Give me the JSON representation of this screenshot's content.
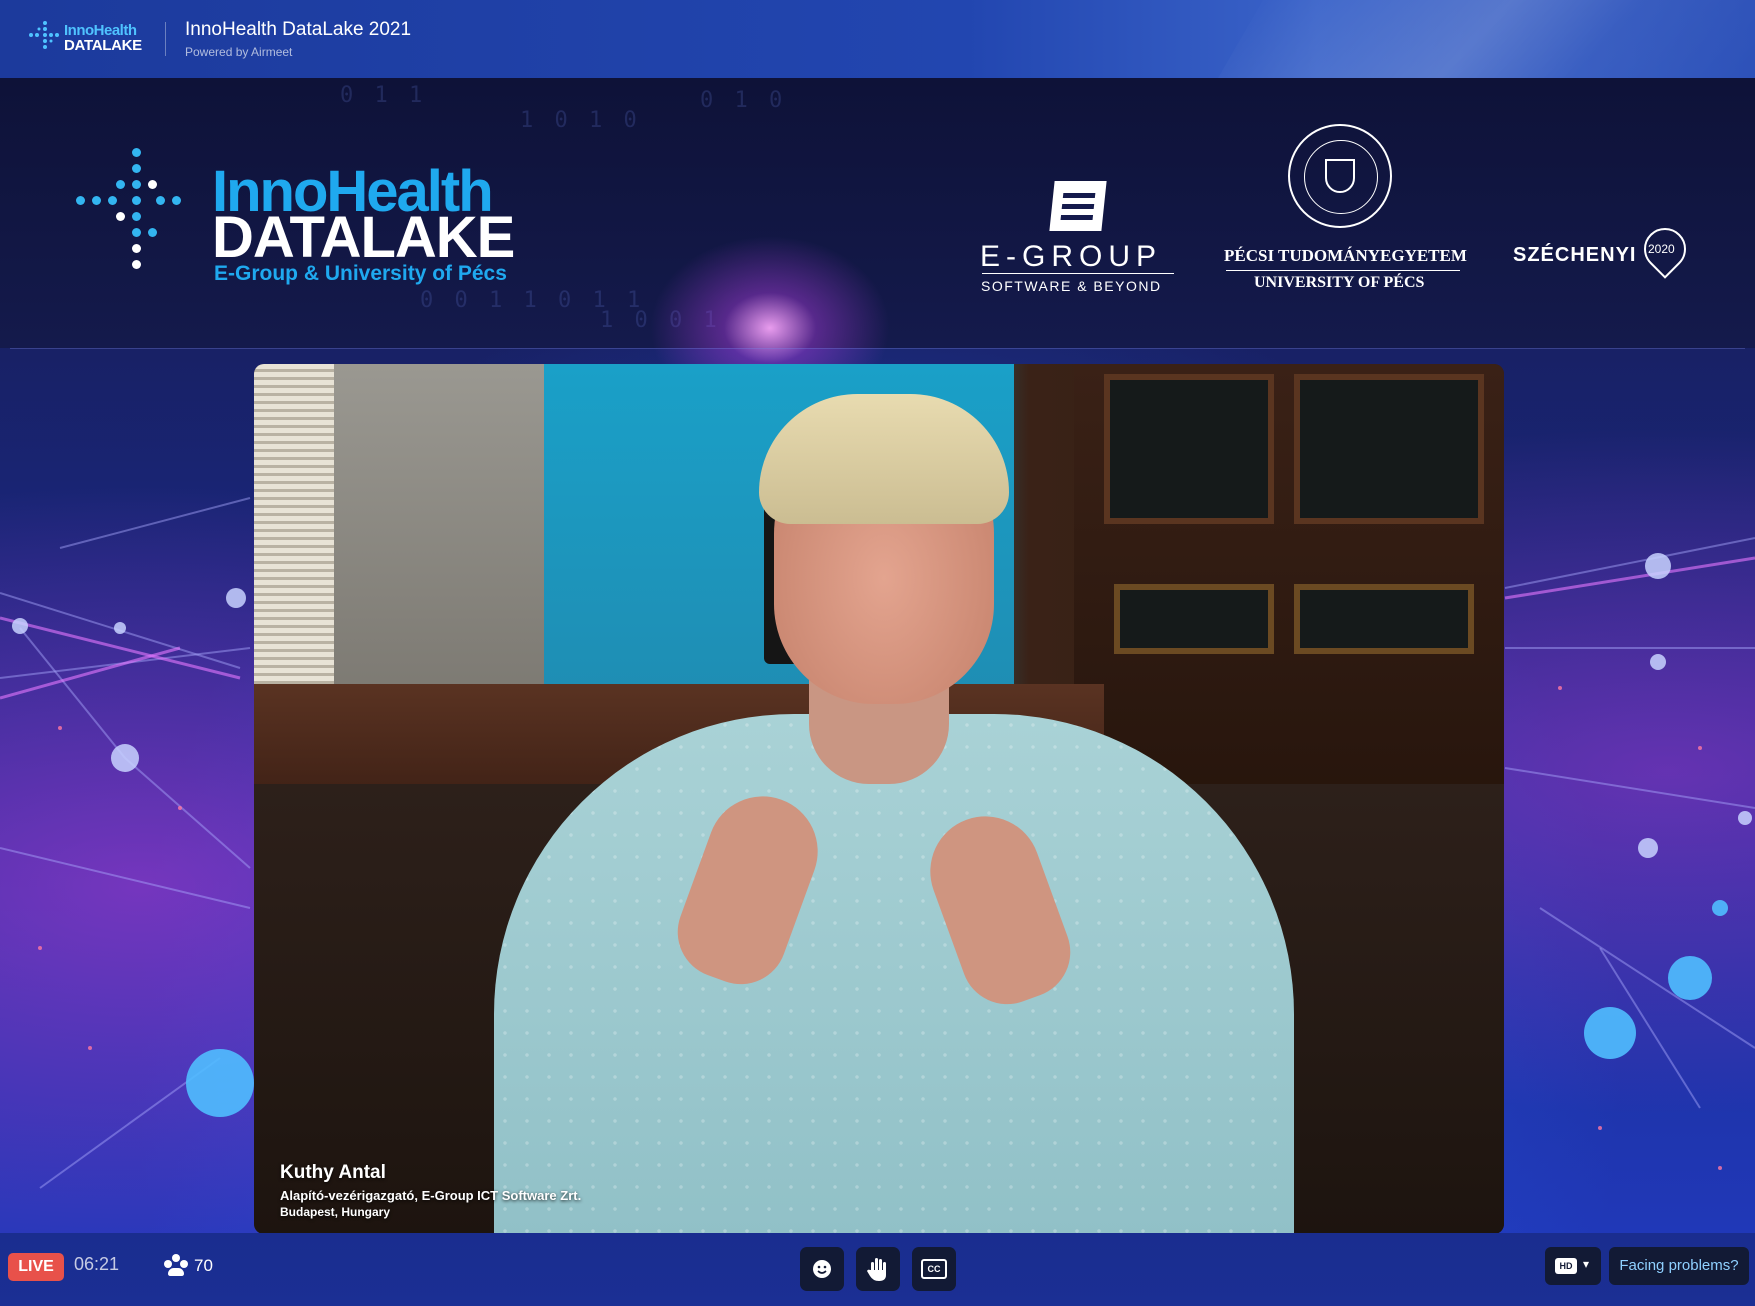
{
  "header": {
    "logo_line1": "InnoHealth",
    "logo_line2": "DATALAKE",
    "title": "InnoHealth DataLake 2021",
    "subtitle": "Powered by Airmeet"
  },
  "banner": {
    "logo_line1": "InnoHealth",
    "logo_line2": "DATALAKE",
    "logo_tagline": "E-Group & University of Pécs",
    "egroup_name": "E-GROUP",
    "egroup_tagline": "SOFTWARE & BEYOND",
    "university_name_hu": "PÉCSI TUDOMÁNYEGYETEM",
    "university_name_en": "UNIVERSITY OF PÉCS",
    "szechenyi_name": "SZÉCHENYI",
    "szechenyi_year": "2020"
  },
  "speaker": {
    "name": "Kuthy Antal",
    "role": "Alapító-vezérigazgató, E-Group ICT Software Zrt.",
    "location": "Budapest, Hungary"
  },
  "footer": {
    "live_label": "LIVE",
    "elapsed": "06:21",
    "attendee_count": "70",
    "quality_label": "HD",
    "help_label": "Facing problems?"
  },
  "icons": {
    "emoji": "emoji-icon",
    "raise_hand": "hand-icon",
    "captions": "cc-icon",
    "attendees": "people-icon"
  },
  "colors": {
    "live_badge": "#e8514a",
    "brand_blue": "#1fa9ef",
    "help_text": "#8fd0ff"
  }
}
